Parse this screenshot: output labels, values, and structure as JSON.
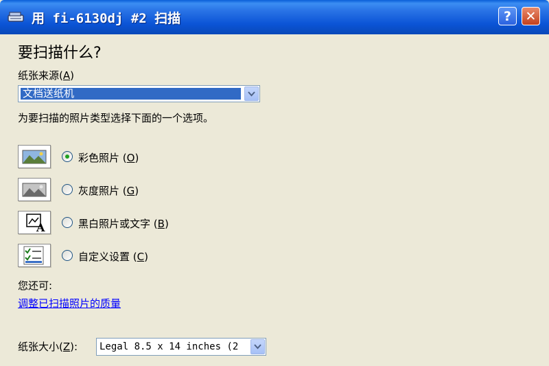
{
  "window": {
    "title": "用 fi-6130dj #2 扫描",
    "help_label": "?",
    "close_label": "✕"
  },
  "main": {
    "heading": "要扫描什么?",
    "paper_source": {
      "label": "纸张来源",
      "accelerator": "A",
      "value": "文档送纸机"
    },
    "instruction": "为要扫描的照片类型选择下面的一个选项。",
    "options": [
      {
        "label": "彩色照片",
        "accelerator": "O",
        "selected": true,
        "icon": "color-photo-icon"
      },
      {
        "label": "灰度照片",
        "accelerator": "G",
        "selected": false,
        "icon": "grayscale-photo-icon"
      },
      {
        "label": "黑白照片或文字",
        "accelerator": "B",
        "selected": false,
        "icon": "bw-text-icon"
      },
      {
        "label": "自定义设置",
        "accelerator": "C",
        "selected": false,
        "icon": "custom-settings-icon"
      }
    ],
    "also_text": "您还可:",
    "adjust_link": "调整已扫描照片的质量",
    "paper_size": {
      "label": "纸张大小",
      "accelerator": "Z",
      "value": "Legal 8.5 x 14 inches (2"
    }
  },
  "colors": {
    "title_bar": "#0b54d6",
    "background": "#ece9d8",
    "selection": "#316ac5",
    "link": "#0000ff",
    "radio_dot": "#21a121"
  }
}
